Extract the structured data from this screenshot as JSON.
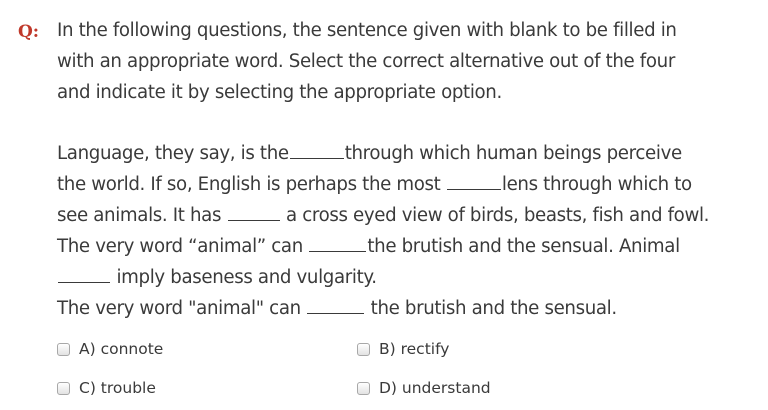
{
  "question": {
    "label": "Q:",
    "instruction_lines": [
      "In the following questions, the sentence given with blank to be filled in",
      "with an appropriate word. Select the correct alternative out of the four",
      "and indicate it by selecting the appropriate option."
    ],
    "passage": {
      "l1a": "Language, they say, is the",
      "l1b": "through which human beings perceive",
      "l2a": "the world. If so, English is perhaps the most",
      "l2b": "lens through which to",
      "l3a": "see animals. It has",
      "l3b": "a cross eyed view of birds, beasts, fish and fowl.",
      "l4a": "The very word “animal” can",
      "l4b": "the brutish and the sensual. Animal",
      "l5b": "imply baseness and vulgarity.",
      "l6a": "The very word \"animal\" can",
      "l6b": "the brutish and the sensual."
    }
  },
  "options": [
    {
      "label": "A) connote"
    },
    {
      "label": "B) rectify"
    },
    {
      "label": "C) trouble"
    },
    {
      "label": "D) understand"
    }
  ]
}
